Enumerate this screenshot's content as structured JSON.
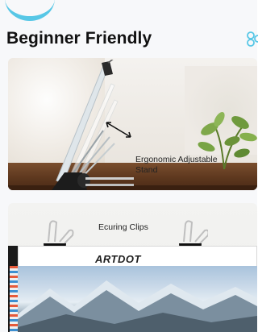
{
  "section": {
    "title": "Beginner Friendly"
  },
  "icons": {
    "share": "share-icon",
    "plant": "plant-icon",
    "stand": "stand-illustration",
    "clip": "binder-clip-icon",
    "arrow": "adjust-arrow-icon"
  },
  "card_stand": {
    "caption": "Ergonomic Adjustable Stand"
  },
  "card_clips": {
    "caption": "Ecuring Clips",
    "brand": "ARTDOT"
  },
  "colors": {
    "accent": "#57c7e6",
    "title": "#111111",
    "wood": "#5b361d"
  }
}
